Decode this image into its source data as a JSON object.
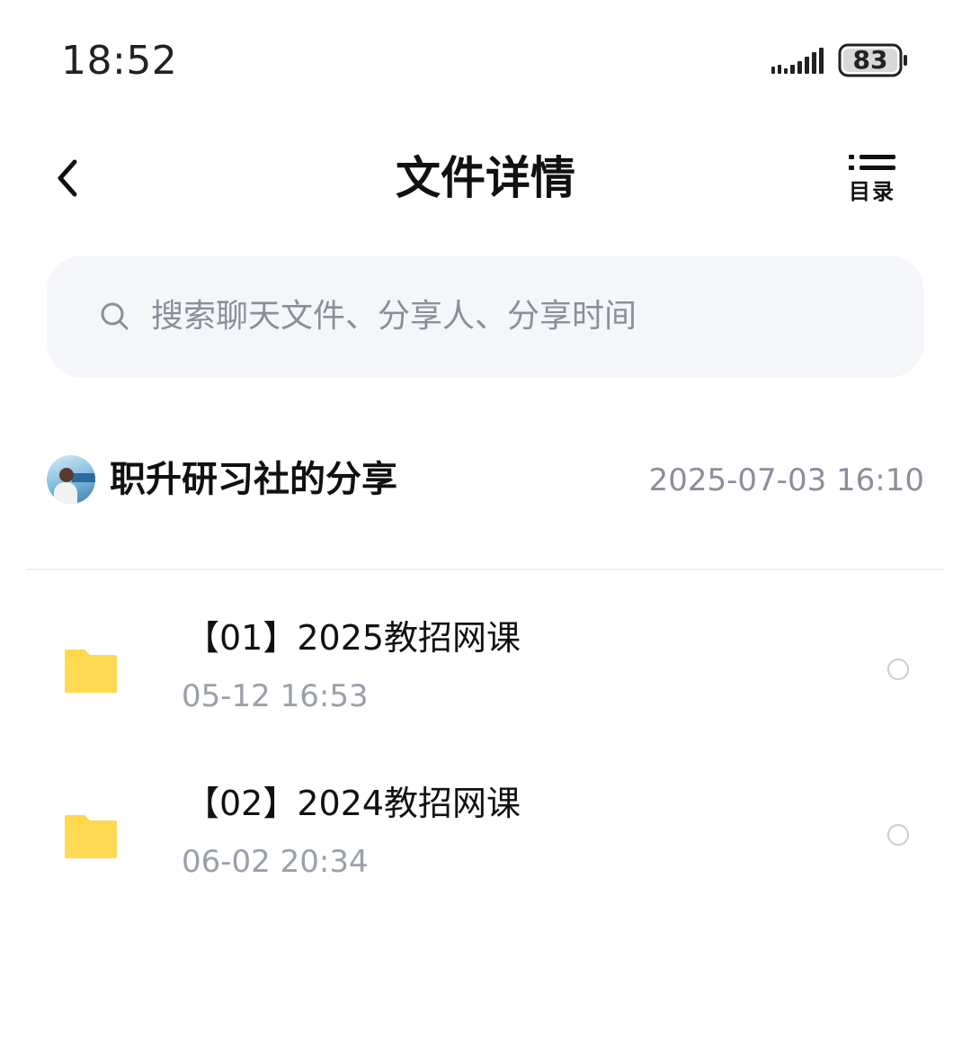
{
  "status_bar": {
    "time": "18:52",
    "battery": "83",
    "signal_icon": "signal-bars-icon",
    "battery_icon": "battery-icon"
  },
  "header": {
    "back_icon": "chevron-left-icon",
    "title": "文件详情",
    "toc_label": "目录",
    "toc_icon": "list-icon"
  },
  "search": {
    "icon": "search-icon",
    "placeholder": "搜索聊天文件、分享人、分享时间"
  },
  "share": {
    "title": "职升研习社的分享",
    "time": "2025-07-03  16:10"
  },
  "files": [
    {
      "icon": "folder-icon",
      "name": "【01】2025教招网课",
      "time": "05-12  16:53",
      "selected": false
    },
    {
      "icon": "folder-icon",
      "name": "【02】2024教招网课",
      "time": "06-02  20:34",
      "selected": false
    }
  ],
  "colors": {
    "folder": "#FFD84D",
    "search_bg": "#F4F6FA",
    "secondary_text": "#8A8F99"
  }
}
